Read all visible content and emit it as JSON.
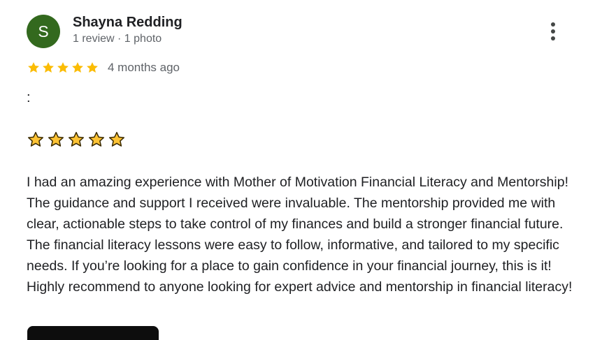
{
  "review": {
    "avatar_letter": "S",
    "avatar_color": "#33691e",
    "reviewer_name": "Shayna Redding",
    "reviewer_meta": "1 review · 1 photo",
    "rating": 5,
    "rating_max": 5,
    "star_color": "#fbbc04",
    "age": "4 months ago",
    "colon_line": ":",
    "emoji_stars": "⭐⭐⭐⭐⭐",
    "text": "I had an amazing experience with Mother of Motivation Financial Literacy and Mentorship! The guidance and support I received were invaluable. The mentorship provided me with clear, actionable steps to take control of my finances and build a stronger financial future. The financial literacy lessons were easy to follow, informative, and tailored to my specific needs. If you’re looking for a place to gain confidence in your financial journey, this is it! Highly recommend to anyone looking for expert advice and mentorship in financial literacy!"
  },
  "icons": {
    "more": "more-vert-icon",
    "rating_star": "star-icon",
    "emoji_star": "star-emoji-icon"
  }
}
